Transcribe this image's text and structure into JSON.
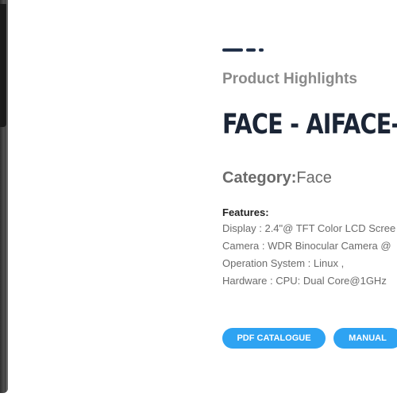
{
  "product": {
    "eyebrow": "Product Highlights",
    "title": "FACE - AIFACE-",
    "category_label": "Category:",
    "category_value": "Face",
    "features_heading": "Features:",
    "features": [
      "Display : 2.4\"@ TFT Color LCD Scree",
      "Camera : WDR Binocular Camera @",
      "Operation System : Linux ,",
      "Hardware : CPU: Dual Core@1GHz"
    ]
  },
  "buttons": {
    "catalogue": "PDF CATALOGUE",
    "manual": "MANUAL"
  },
  "colors": {
    "accent": "#2ea3f2",
    "title": "#1b2536",
    "dash": "#22314a"
  }
}
